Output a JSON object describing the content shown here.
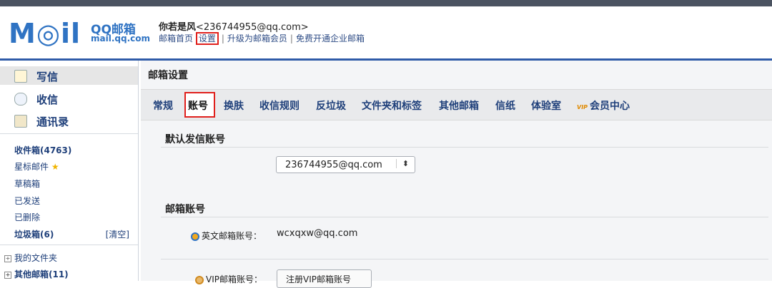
{
  "header": {
    "logo_main": "M◎il",
    "logo_brand": "QQ邮箱",
    "logo_url": "mail.qq.com",
    "user_name": "你若是风",
    "user_email": "<236744955@qq.com>",
    "links": [
      "邮箱首页",
      "设置",
      "升级为邮箱会员",
      "免费开通企业邮箱"
    ]
  },
  "sidebar": {
    "main_items": [
      {
        "label": "写信",
        "icon": "compose-icon"
      },
      {
        "label": "收信",
        "icon": "inbox-icon"
      },
      {
        "label": "通讯录",
        "icon": "contacts-icon"
      }
    ],
    "folders": {
      "inbox": "收件箱(4763)",
      "starred": "星标邮件",
      "drafts": "草稿箱",
      "sent": "已发送",
      "deleted": "已删除",
      "trash": "垃圾箱(6)",
      "trash_clear": "[清空]",
      "my_folders": "我的文件夹",
      "other_mailboxes": "其他邮箱(11)"
    }
  },
  "main": {
    "title": "邮箱设置",
    "tabs": [
      "常规",
      "账号",
      "换肤",
      "收信规则",
      "反垃圾",
      "文件夹和标签",
      "其他邮箱",
      "信纸",
      "体验室",
      "会员中心"
    ],
    "vip_badge": "VIP",
    "default_section_title": "默认发信账号",
    "default_account": "236744955@qq.com",
    "mailbox_section_title": "邮箱账号",
    "english_label": "英文邮箱账号：",
    "english_value": "wcxqxw@qq.com",
    "vip_label": "VIP邮箱账号：",
    "vip_button": "注册VIP邮箱账号"
  },
  "colors": {
    "accent": "#2f73c3",
    "highlight": "#e0201c"
  }
}
